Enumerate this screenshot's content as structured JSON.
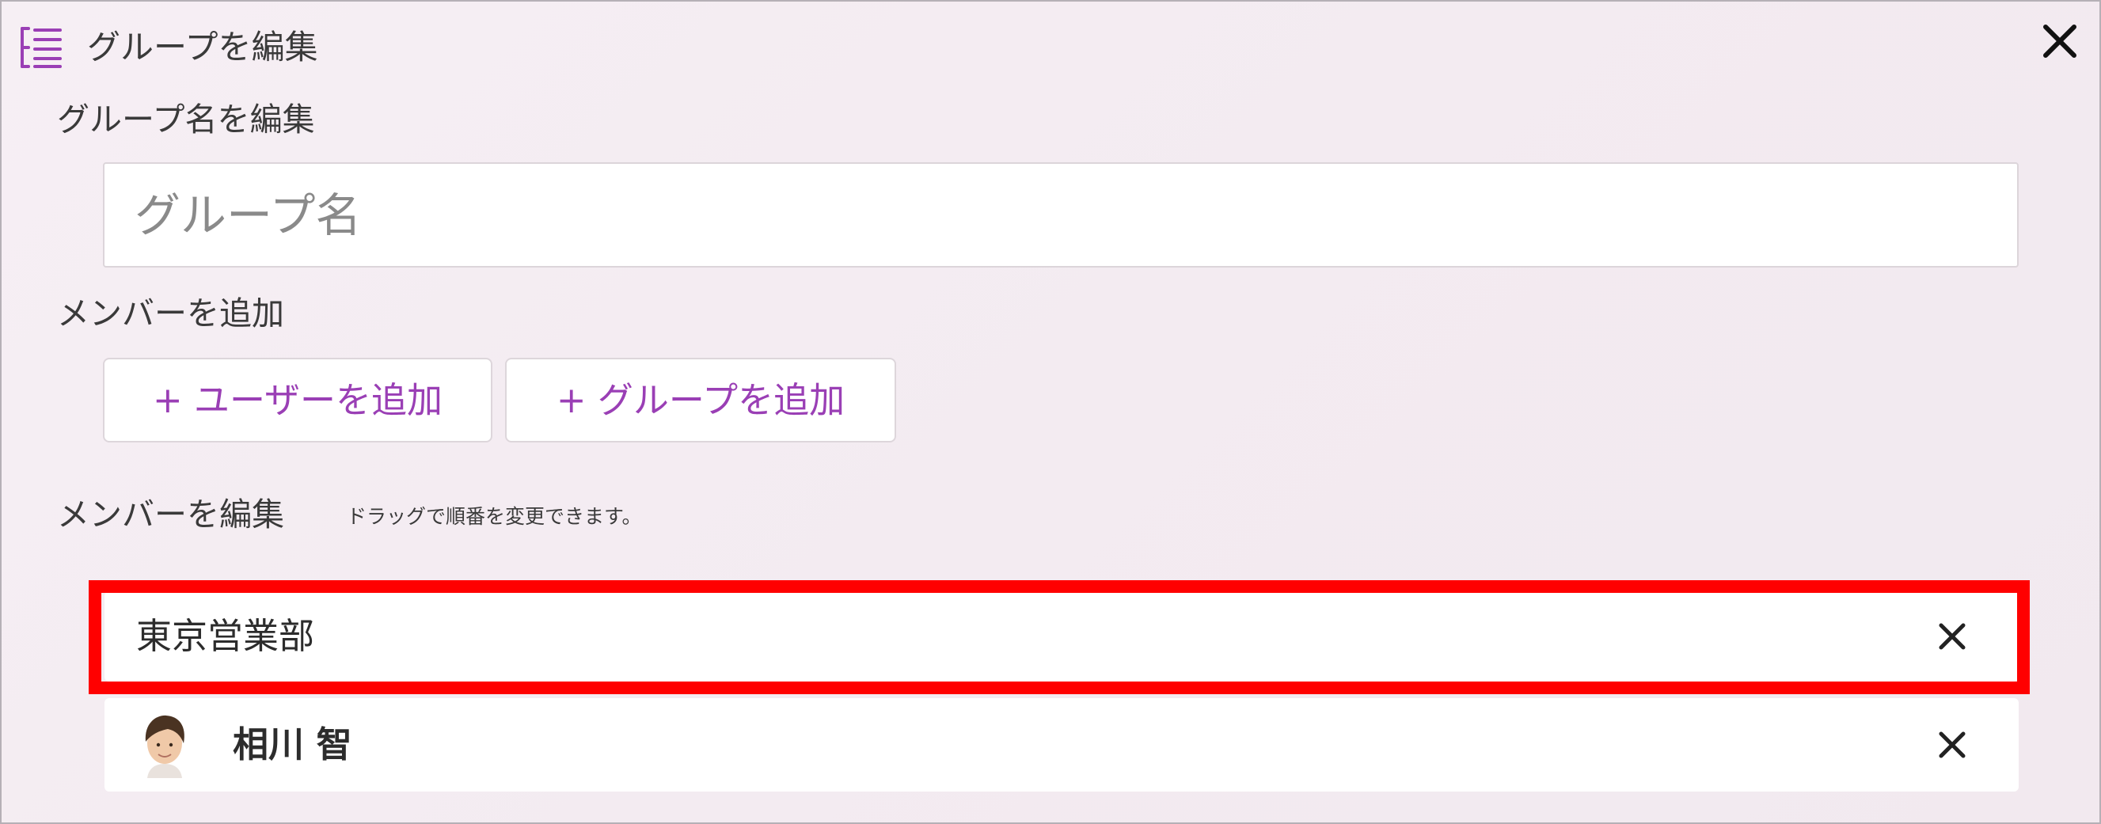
{
  "dialog": {
    "title": "グループを編集",
    "header_icon": "list-tree-icon",
    "close_icon": "close-icon"
  },
  "group_name": {
    "label": "グループ名を編集",
    "placeholder": "グループ名",
    "value": ""
  },
  "add_members": {
    "label": "メンバーを追加",
    "add_user_label": "+ ユーザーを追加",
    "add_group_label": "+ グループを追加"
  },
  "edit_members": {
    "label": "メンバーを編集",
    "hint": "ドラッグで順番を変更できます。",
    "members": [
      {
        "type": "group",
        "name": "東京営業部",
        "highlighted": true
      },
      {
        "type": "user",
        "name": "相川 智",
        "avatar": "user-avatar"
      }
    ]
  },
  "colors": {
    "accent": "#9a3fb5",
    "highlight": "#ff0000",
    "background": "#f4ecf2"
  }
}
